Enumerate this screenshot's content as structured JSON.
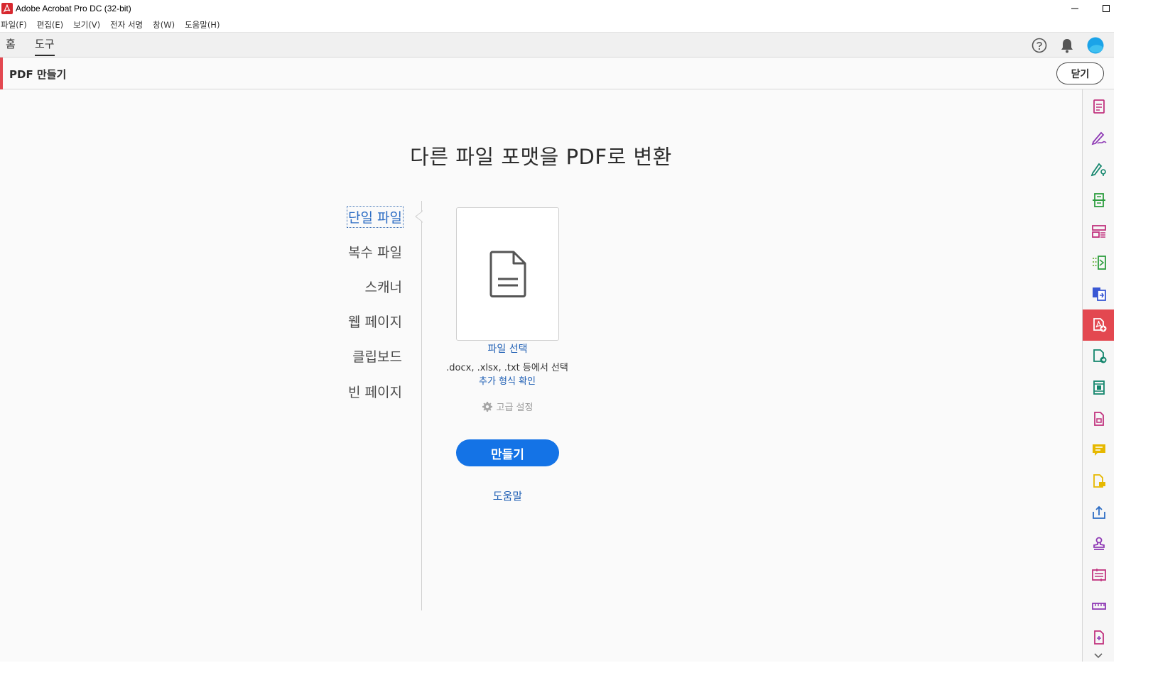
{
  "window": {
    "title": "Adobe Acrobat Pro DC (32-bit)",
    "minimize_icon": "minimize-icon",
    "maximize_icon": "maximize-icon",
    "close_icon": "close-icon"
  },
  "menubar": {
    "items": [
      "파일(F)",
      "편집(E)",
      "보기(V)",
      "전자 서명",
      "창(W)",
      "도움말(H)"
    ]
  },
  "nav": {
    "tabs": [
      "홈",
      "도구"
    ],
    "active_tab": "도구",
    "icons": [
      "help-icon",
      "bell-icon",
      "profile-avatar"
    ]
  },
  "tool_header": {
    "title": "PDF 만들기",
    "close_label": "닫기",
    "accent_color": "#e34850"
  },
  "main": {
    "heading": "다른 파일 포맷을 PDF로 변환",
    "options": [
      "단일 파일",
      "복수 파일",
      "스캐너",
      "웹 페이지",
      "클립보드",
      "빈 페이지"
    ],
    "selected_option": "단일 파일",
    "select_file_link": "파일 선택",
    "formats_text": ".docx, .xlsx, .txt 등에서 선택",
    "more_formats_link": "추가 형식 확인",
    "advanced_settings": "고급 설정",
    "create_button": "만들기",
    "help_link": "도움말",
    "button_color": "#1473e6",
    "link_color": "#1f5fb4"
  },
  "right_panel": {
    "tools": [
      "export-pdf-icon",
      "fill-sign-icon",
      "request-signature-icon",
      "scan-ocr-icon",
      "organize-pages-icon",
      "compare-icon",
      "combine-files-icon",
      "create-pdf-icon",
      "convert-pdf-icon",
      "rich-media-icon",
      "edit-pdf-icon",
      "comment-icon",
      "send-for-comments-icon",
      "share-icon",
      "stamp-icon",
      "prepare-form-icon",
      "measure-icon",
      "more-tools-icon"
    ],
    "active_tool": "create-pdf-icon",
    "scroll_icon": "chevron-down-icon"
  }
}
